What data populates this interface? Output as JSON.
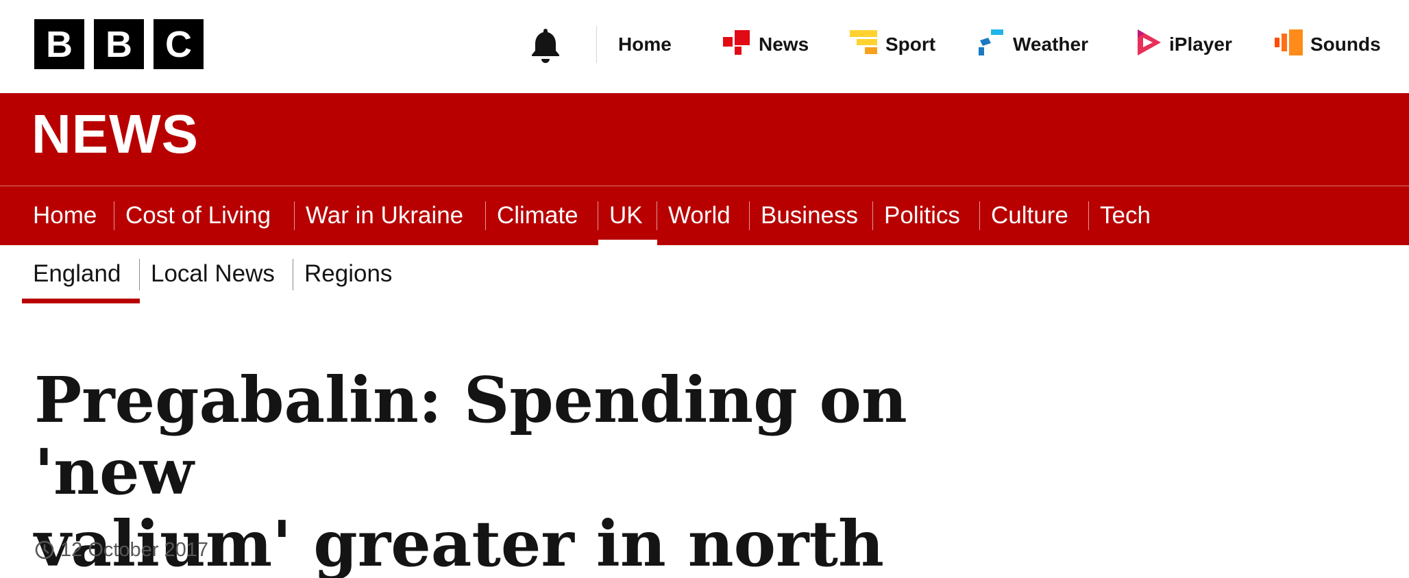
{
  "logo": {
    "letters": [
      "B",
      "B",
      "C"
    ]
  },
  "global_nav": {
    "notifications_icon": "bell-icon",
    "items": [
      {
        "label": "Home",
        "icon": ""
      },
      {
        "label": "News",
        "icon": "news-icon",
        "color": "#e20a15"
      },
      {
        "label": "Sport",
        "icon": "sport-icon",
        "color": "#ffd230"
      },
      {
        "label": "Weather",
        "icon": "weather-icon",
        "color": "#1a7bc2"
      },
      {
        "label": "iPlayer",
        "icon": "iplayer-icon",
        "color": "#e8305a"
      },
      {
        "label": "Sounds",
        "icon": "sounds-icon",
        "color": "#ff6f19"
      }
    ]
  },
  "masthead": {
    "title": "NEWS",
    "color": "#b80000"
  },
  "primary_nav": {
    "items": [
      "Home",
      "Cost of Living",
      "War in Ukraine",
      "Climate",
      "UK",
      "World",
      "Business",
      "Politics",
      "Culture",
      "Tech"
    ],
    "active": "UK"
  },
  "secondary_nav": {
    "items": [
      "England",
      "Local News",
      "Regions"
    ],
    "active": "England"
  },
  "article": {
    "headline_line1": "Pregabalin: Spending on 'new",
    "headline_line2": "valium' greater in north",
    "date": "12 October 2017",
    "date_icon": "clock-icon"
  }
}
